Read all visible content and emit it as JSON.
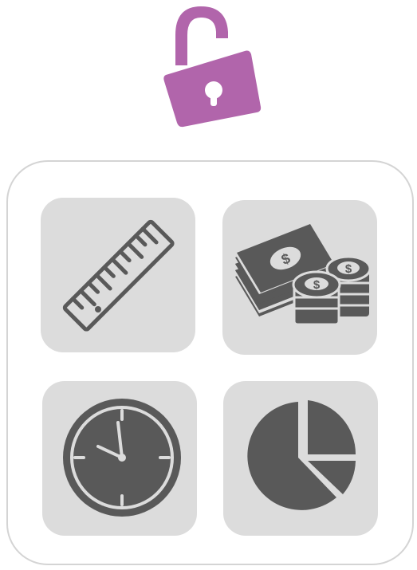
{
  "colors": {
    "lock": "#b165ab",
    "tile_background": "#dcdcdc",
    "icon": "#595959",
    "panel_border": "#d4d4d4"
  },
  "lock": {
    "icon": "unlocked-padlock-icon",
    "state": "unlocked"
  },
  "tiles": [
    {
      "icon": "ruler-icon"
    },
    {
      "icon": "money-stack-and-coins-icon"
    },
    {
      "icon": "clock-icon"
    },
    {
      "icon": "pie-chart-icon"
    }
  ]
}
